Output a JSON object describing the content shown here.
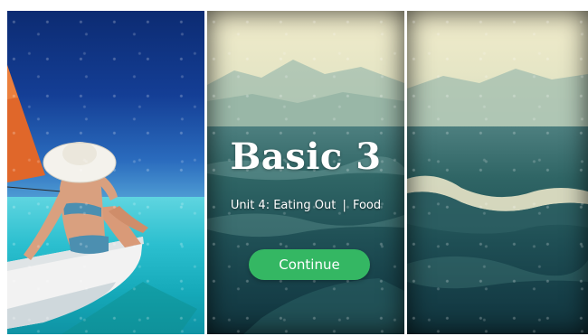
{
  "course": {
    "title": "Basic 3",
    "unit": "Unit 4: Eating Out",
    "separator": "|",
    "topic": "Food"
  },
  "actions": {
    "continue_label": "Continue"
  },
  "colors": {
    "accent": "#34b763",
    "text": "#ffffff",
    "sea_left": "#2bbfcf",
    "sky_left": "#143e95",
    "sky_vintage": "#e5e5c5",
    "sea_vintage": "#1f4f55"
  },
  "panels": [
    {
      "name": "beach-sailboat-photo"
    },
    {
      "name": "ocean-waves-photo-center"
    },
    {
      "name": "ocean-waves-photo-right"
    }
  ]
}
